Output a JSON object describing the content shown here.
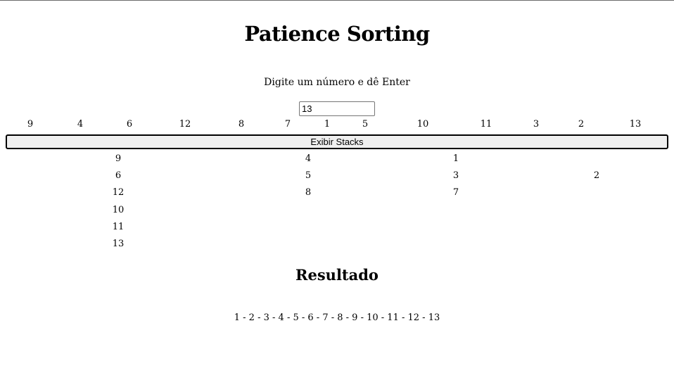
{
  "title": "Patience Sorting",
  "prompt": "Digite um número e dê Enter",
  "input": {
    "value": "13"
  },
  "entered_numbers": [
    "9",
    "4",
    "6",
    "12",
    "8",
    "7",
    "1",
    "5",
    "10",
    "11",
    "3",
    "2",
    "13"
  ],
  "show_stacks_button": "Exibir Stacks",
  "stacks": [
    [
      "9",
      "6",
      "12",
      "10",
      "11",
      "13"
    ],
    [
      "4",
      "5",
      "8"
    ],
    [
      "1",
      "3",
      "7"
    ],
    [
      "2"
    ]
  ],
  "result_heading": "Resultado",
  "result": "1 - 2 - 3 - 4 - 5 - 6 - 7 - 8 - 9 - 10 - 11 - 12 - 13"
}
